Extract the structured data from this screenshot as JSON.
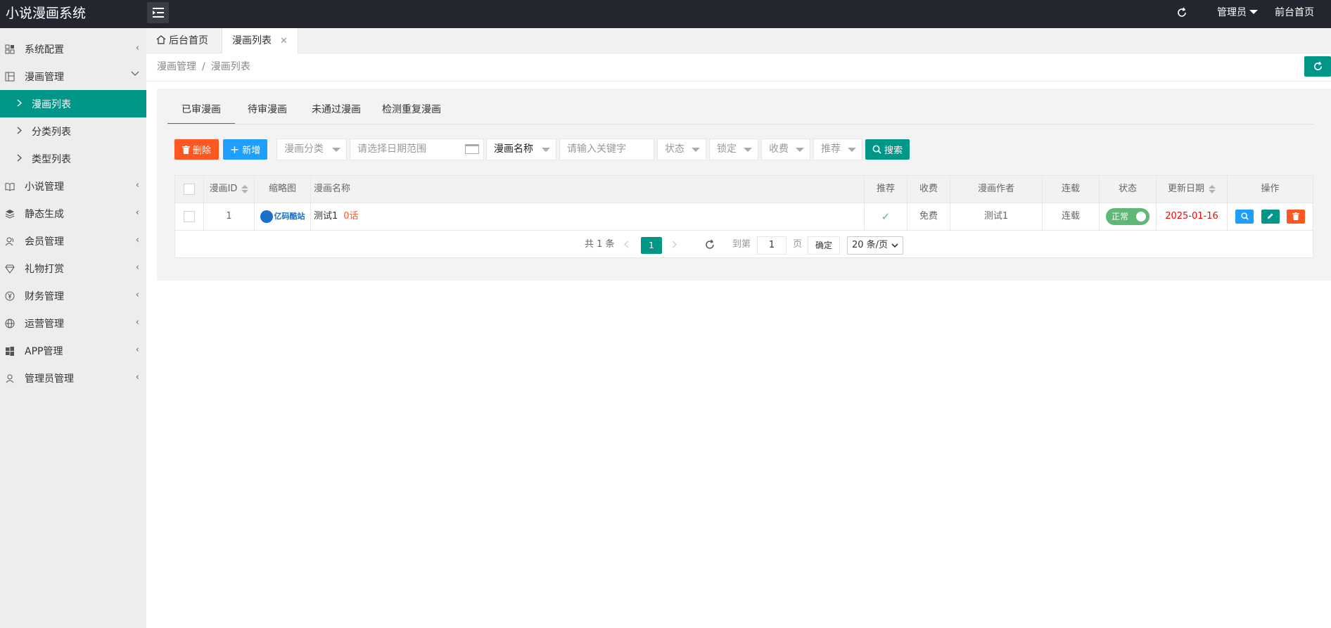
{
  "app": {
    "title": "小说漫画系统"
  },
  "header": {
    "admin": "管理员",
    "front_home": "前台首页"
  },
  "sidebar": {
    "items": [
      {
        "label": "系统配置",
        "icon": "grid-icon"
      },
      {
        "label": "漫画管理",
        "icon": "comic-icon"
      },
      {
        "label": "小说管理",
        "icon": "book-icon"
      },
      {
        "label": "静态生成",
        "icon": "layers-icon"
      },
      {
        "label": "会员管理",
        "icon": "users-icon"
      },
      {
        "label": "礼物打赏",
        "icon": "diamond-icon"
      },
      {
        "label": "财务管理",
        "icon": "yen-icon"
      },
      {
        "label": "运营管理",
        "icon": "globe-icon"
      },
      {
        "label": "APP管理",
        "icon": "windows-icon"
      },
      {
        "label": "管理员管理",
        "icon": "user-icon"
      }
    ],
    "subitems": [
      "漫画列表",
      "分类列表",
      "类型列表"
    ]
  },
  "tabs": {
    "home": "后台首页",
    "current": "漫画列表"
  },
  "breadcrumb": {
    "parent": "漫画管理",
    "current": "漫画列表"
  },
  "subtabs": [
    "已审漫画",
    "待审漫画",
    "未通过漫画",
    "检测重复漫画"
  ],
  "toolbar": {
    "delete": "删除",
    "add": "新增",
    "category": "漫画分类",
    "date_placeholder": "请选择日期范围",
    "field": "漫画名称",
    "keyword_placeholder": "请输入关键字",
    "status": "状态",
    "lock": "锁定",
    "charge": "收费",
    "recommend": "推荐",
    "search": "搜索"
  },
  "table": {
    "columns": [
      "漫画ID",
      "缩略图",
      "漫画名称",
      "推荐",
      "收费",
      "漫画作者",
      "连载",
      "状态",
      "更新日期",
      "操作"
    ],
    "rows": [
      {
        "id": "1",
        "thumb_text": "亿码酷站",
        "name": "测试1",
        "episodes": "0话",
        "charge": "免费",
        "author": "测试1",
        "serial": "连载",
        "status": "正常",
        "date": "2025-01-16"
      }
    ]
  },
  "pagination": {
    "total": "共 1 条",
    "current_page": "1",
    "goto_label": "到第",
    "page_label": "页",
    "goto_value": "1",
    "confirm": "确定",
    "page_size": "20 条/页"
  },
  "colors": {
    "primary": "#009688",
    "danger": "#ff5722",
    "info": "#1e9fff",
    "header": "#23262e"
  }
}
